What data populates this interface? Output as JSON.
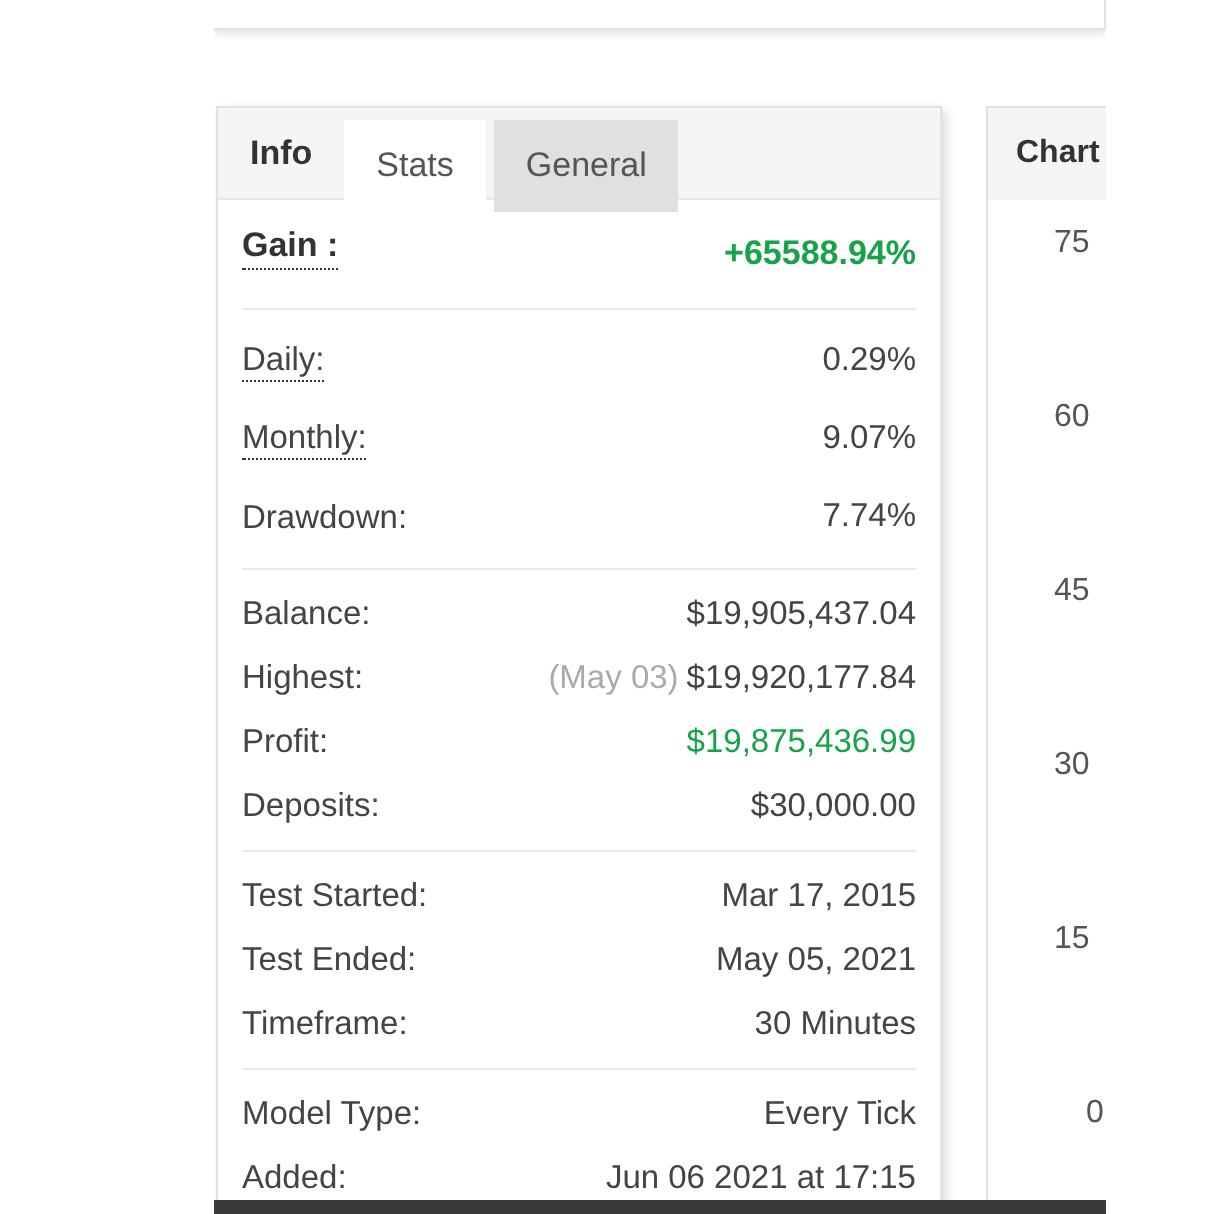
{
  "tabs": [
    {
      "label": "Info",
      "selected": false,
      "highlighted": false
    },
    {
      "label": "Stats",
      "selected": true,
      "highlighted": false
    },
    {
      "label": "General",
      "selected": false,
      "highlighted": true
    }
  ],
  "gain": {
    "label": "Gain :",
    "value": "+65588.94%"
  },
  "groups": [
    {
      "rows": [
        {
          "label": "Daily:",
          "value": "0.29%",
          "hint": true,
          "positive": false
        },
        {
          "label": "Monthly:",
          "value": "9.07%",
          "hint": true,
          "positive": false
        },
        {
          "label": "Drawdown:",
          "value": "7.74%",
          "hint": false,
          "positive": false
        }
      ]
    },
    {
      "rows": [
        {
          "label": "Balance:",
          "value": "$19,905,437.04",
          "hint": false,
          "positive": false
        },
        {
          "label": "Highest:",
          "note": "(May 03)",
          "value": "$19,920,177.84",
          "hint": false,
          "positive": false
        },
        {
          "label": "Profit:",
          "value": "$19,875,436.99",
          "hint": false,
          "positive": true
        },
        {
          "label": "Deposits:",
          "value": "$30,000.00",
          "hint": false,
          "positive": false
        }
      ]
    },
    {
      "rows": [
        {
          "label": "Test Started:",
          "value": "Mar 17, 2015",
          "hint": false,
          "positive": false
        },
        {
          "label": "Test Ended:",
          "value": "May 05, 2021",
          "hint": false,
          "positive": false
        },
        {
          "label": "Timeframe:",
          "value": "30 Minutes",
          "hint": false,
          "positive": false
        }
      ]
    },
    {
      "rows": [
        {
          "label": "Model Type:",
          "value": "Every Tick",
          "hint": false,
          "positive": false
        },
        {
          "label": "Added:",
          "value": "Jun 06 2021 at 17:15",
          "hint": false,
          "positive": false
        }
      ]
    }
  ],
  "chart": {
    "title": "Chart",
    "y_labels": [
      "75",
      "60",
      "45",
      "30",
      "15",
      "0"
    ]
  }
}
